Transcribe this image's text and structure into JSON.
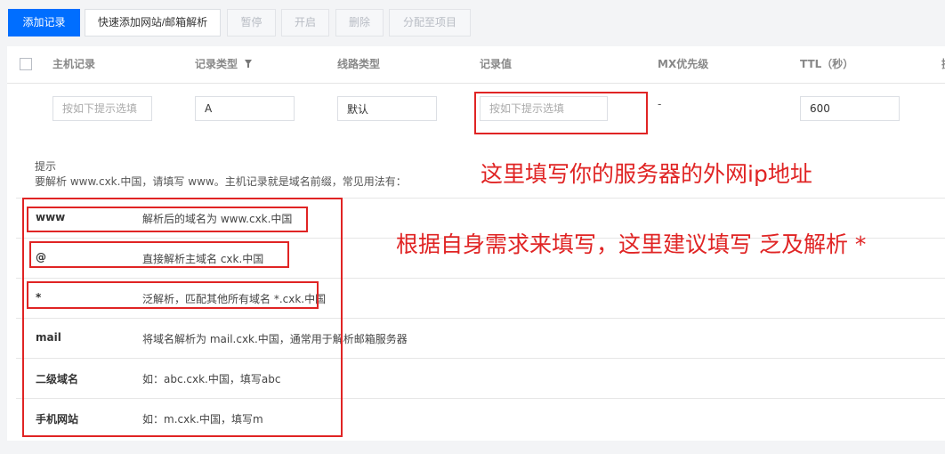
{
  "toolbar": {
    "add_record": "添加记录",
    "quick_add": "快速添加网站/邮箱解析",
    "pause": "暂停",
    "enable": "开启",
    "delete": "删除",
    "assign_project": "分配至项目"
  },
  "table": {
    "columns": [
      "主机记录",
      "记录类型",
      "线路类型",
      "记录值",
      "MX优先级",
      "TTL（秒）",
      "操"
    ]
  },
  "edit_row": {
    "host_placeholder": "按如下提示选填",
    "record_type": "A",
    "line_type": "默认",
    "value_placeholder": "按如下提示选填",
    "mx_priority": "-",
    "ttl": "600"
  },
  "hint": {
    "title": "提示",
    "description": "要解析 www.cxk.中国，请填写 www。主机记录就是域名前缀，常见用法有：",
    "rows": [
      {
        "key": "www",
        "value": "解析后的域名为 www.cxk.中国"
      },
      {
        "key": "@",
        "value": "直接解析主域名 cxk.中国"
      },
      {
        "key": "*",
        "value": "泛解析，匹配其他所有域名 *.cxk.中国"
      },
      {
        "key": "mail",
        "value": "将域名解析为 mail.cxk.中国，通常用于解析邮箱服务器"
      },
      {
        "key": "二级域名",
        "value": "如：abc.cxk.中国，填写abc"
      },
      {
        "key": "手机网站",
        "value": "如：m.cxk.中国，填写m"
      }
    ]
  },
  "annotations": {
    "server_ip_note": "这里填写你的服务器的外网ip地址",
    "host_note": "根据自身需求来填写，这里建议填写 乏及解析  *",
    "color": "#e02424"
  },
  "colors": {
    "primary": "#006eff",
    "background": "#f3f4f6"
  }
}
